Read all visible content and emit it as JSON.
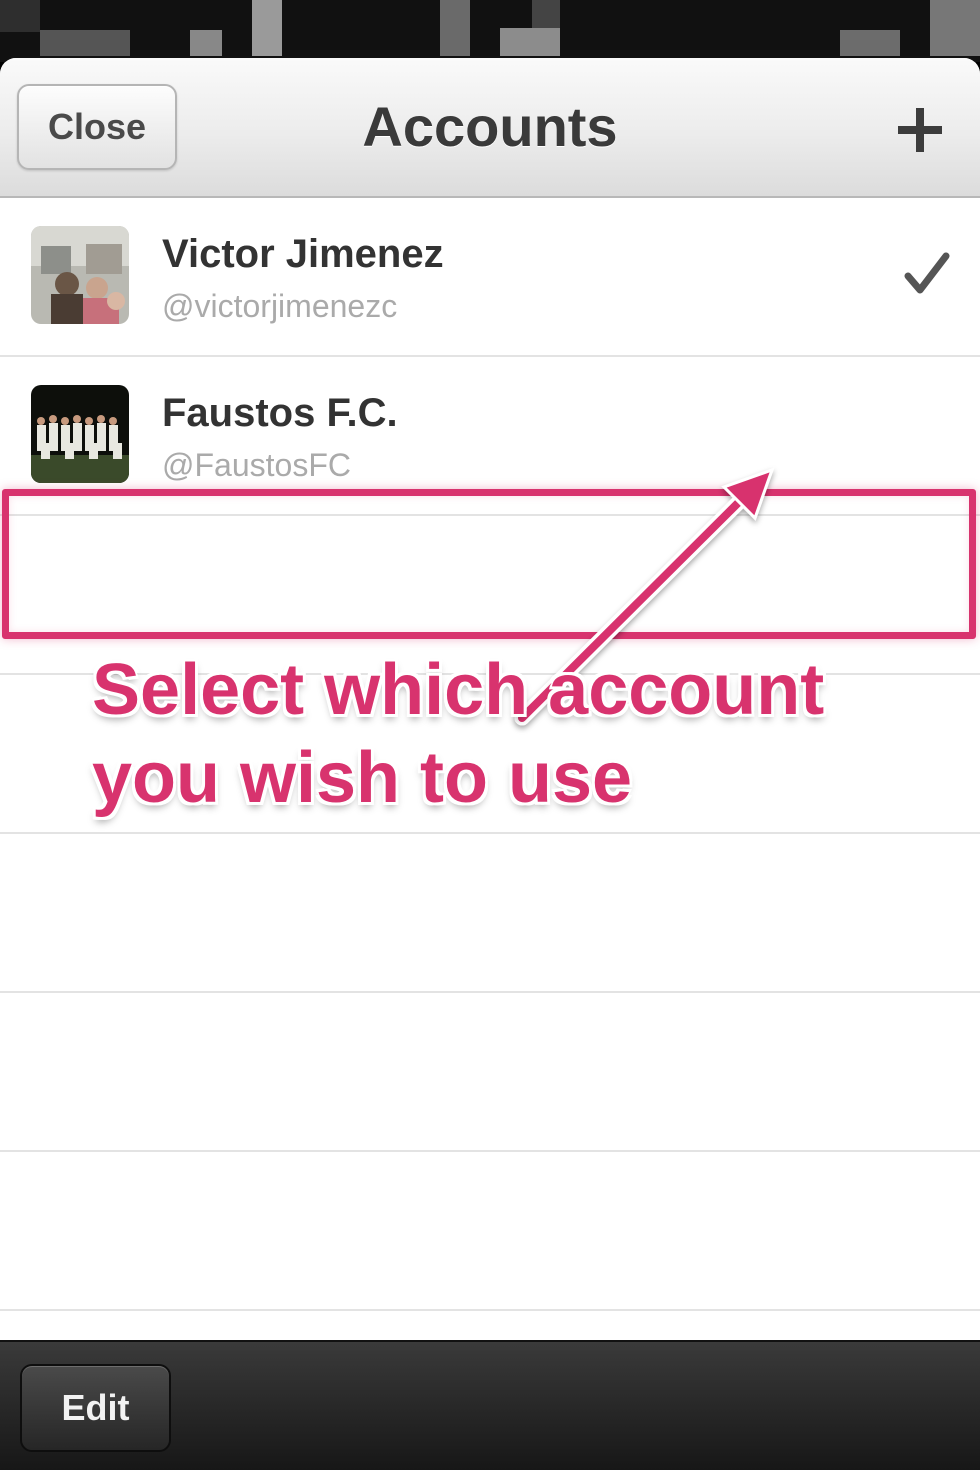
{
  "navbar": {
    "close_label": "Close",
    "title": "Accounts",
    "add_icon": "plus-icon"
  },
  "accounts": [
    {
      "name": "Victor Jimenez",
      "handle": "@victorjimenezc",
      "selected": true,
      "status_icon": "checkmark-icon"
    },
    {
      "name": "Faustos F.C.",
      "handle": "@FaustosFC",
      "selected": false
    }
  ],
  "annotation": {
    "lines": [
      "Select which account",
      "you wish to use"
    ],
    "color": "#d8336e"
  },
  "toolbar": {
    "edit_label": "Edit"
  },
  "colors": {
    "accent": "#d8336e",
    "title_text": "#3a3a3a",
    "handle_text": "#aaaaaa",
    "toolbar_bg": "#2a2a2a"
  }
}
